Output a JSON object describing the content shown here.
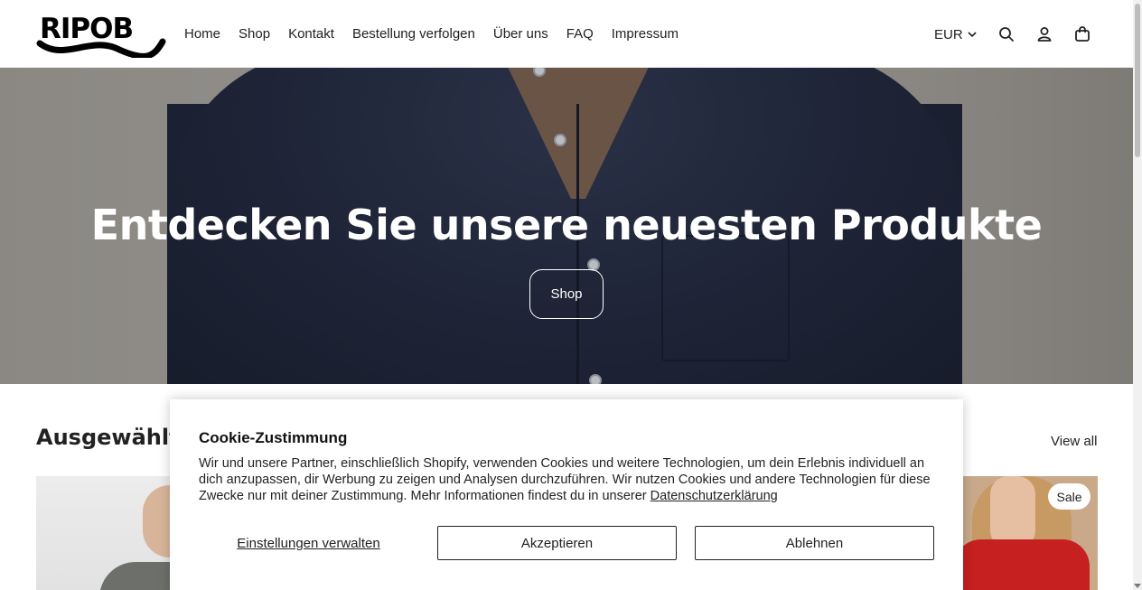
{
  "brand": {
    "logo_text": "RIPOB"
  },
  "nav": {
    "items": [
      "Home",
      "Shop",
      "Kontakt",
      "Bestellung verfolgen",
      "Über uns",
      "FAQ",
      "Impressum"
    ]
  },
  "header_tools": {
    "currency": "EUR",
    "icons": [
      "chevron-down-icon",
      "search-icon",
      "account-icon",
      "cart-icon"
    ]
  },
  "hero": {
    "title": "Entdecken Sie unsere neuesten Produkte",
    "button_label": "Shop"
  },
  "featured": {
    "title": "Ausgewählte",
    "view_all_label": "View all",
    "sale_badge": "Sale"
  },
  "cookie": {
    "title": "Cookie-Zustimmung",
    "text": "Wir und unsere Partner, einschließlich Shopify, verwenden Cookies und weitere Technologien, um dein Erlebnis individuell an dich anzupassen, dir Werbung zu zeigen und Analysen durchzuführen. Wir nutzen Cookies und andere Technologien für diese Zwecke nur mit deiner Zustimmung. Mehr Informationen findest du in unserer",
    "privacy_link": "Datenschutzerklärung",
    "manage_label": "Einstellungen verwalten",
    "accept_label": "Akzeptieren",
    "decline_label": "Ablehnen"
  }
}
